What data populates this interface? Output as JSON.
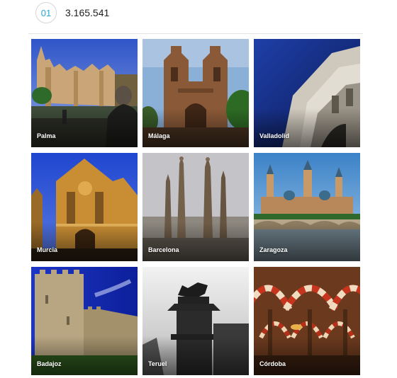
{
  "header": {
    "rank": "01",
    "count": "3.165.541"
  },
  "cities": [
    {
      "label": "Palma",
      "photo": "palma-cathedral"
    },
    {
      "label": "Málaga",
      "photo": "malaga-cathedral"
    },
    {
      "label": "Valladolid",
      "photo": "valladolid-facade"
    },
    {
      "label": "Murcia",
      "photo": "murcia-cathedral"
    },
    {
      "label": "Barcelona",
      "photo": "sagrada-familia-spires"
    },
    {
      "label": "Zaragoza",
      "photo": "basilica-del-pilar"
    },
    {
      "label": "Badajoz",
      "photo": "alcazaba-tower"
    },
    {
      "label": "Teruel",
      "photo": "torico-statue"
    },
    {
      "label": "Córdoba",
      "photo": "mezquita-arches"
    }
  ]
}
